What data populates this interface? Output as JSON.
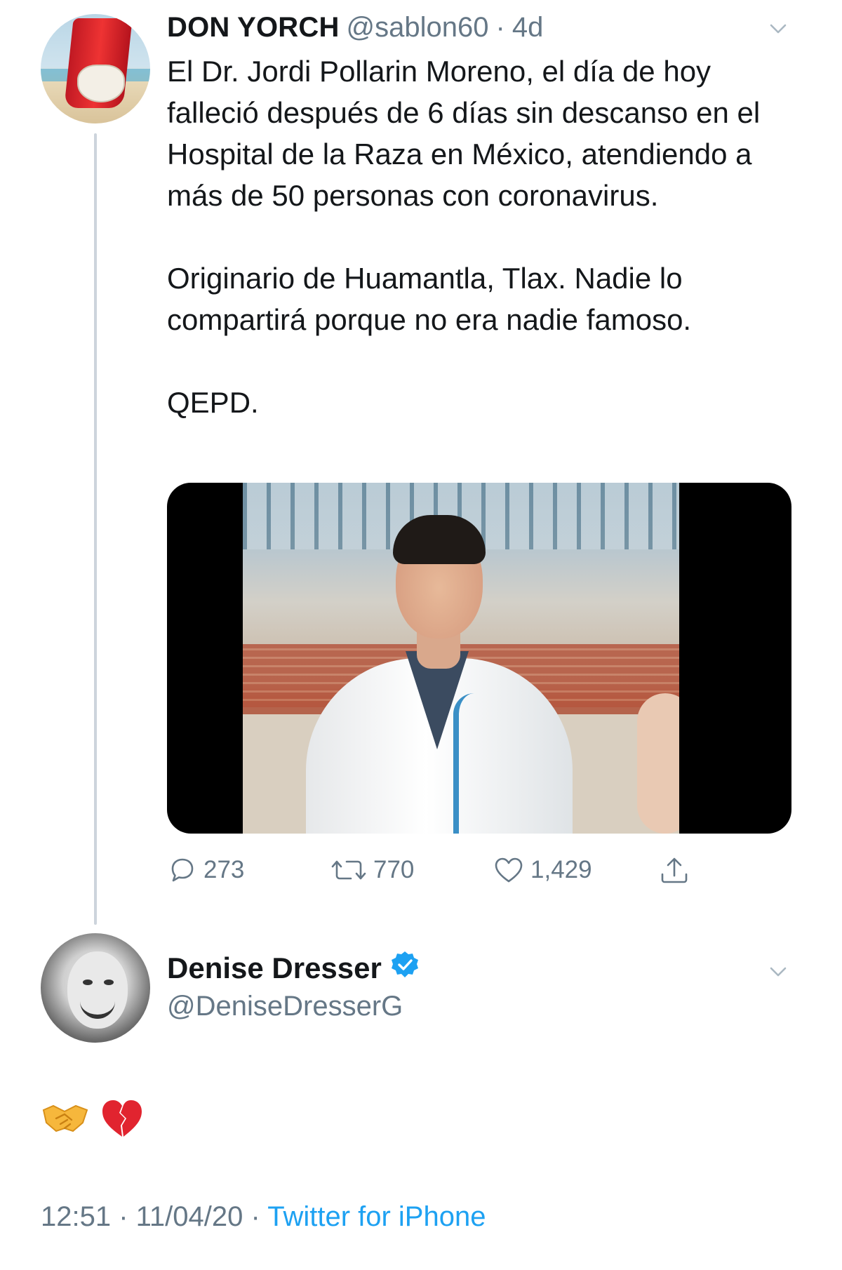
{
  "tweet1": {
    "display_name": "DON YORCH",
    "handle": "@sablon60",
    "separator": "·",
    "age": "4d",
    "paragraphs": [
      "El Dr. Jordi Pollarin Moreno, el día de hoy falleció después de 6 días sin descanso en el Hospital de la Raza en México, atendiendo a más de 50 personas con coronavirus.",
      "Originario de Huamantla, Tlax. Nadie lo compartirá porque no era nadie famoso.",
      "QEPD."
    ],
    "actions": {
      "replies": "273",
      "retweets": "770",
      "likes": "1,429"
    }
  },
  "tweet2": {
    "display_name": "Denise Dresser",
    "handle": "@DeniseDresserG",
    "verified": true,
    "emojis": [
      "handshake",
      "broken-heart"
    ],
    "meta": {
      "time": "12:51",
      "separator1": " · ",
      "date": "11/04/20",
      "separator2": " · ",
      "source": "Twitter for iPhone"
    }
  },
  "colors": {
    "text": "#14171a",
    "muted": "#657786",
    "link": "#1da1f2",
    "thread_line": "#cdd4dc"
  }
}
